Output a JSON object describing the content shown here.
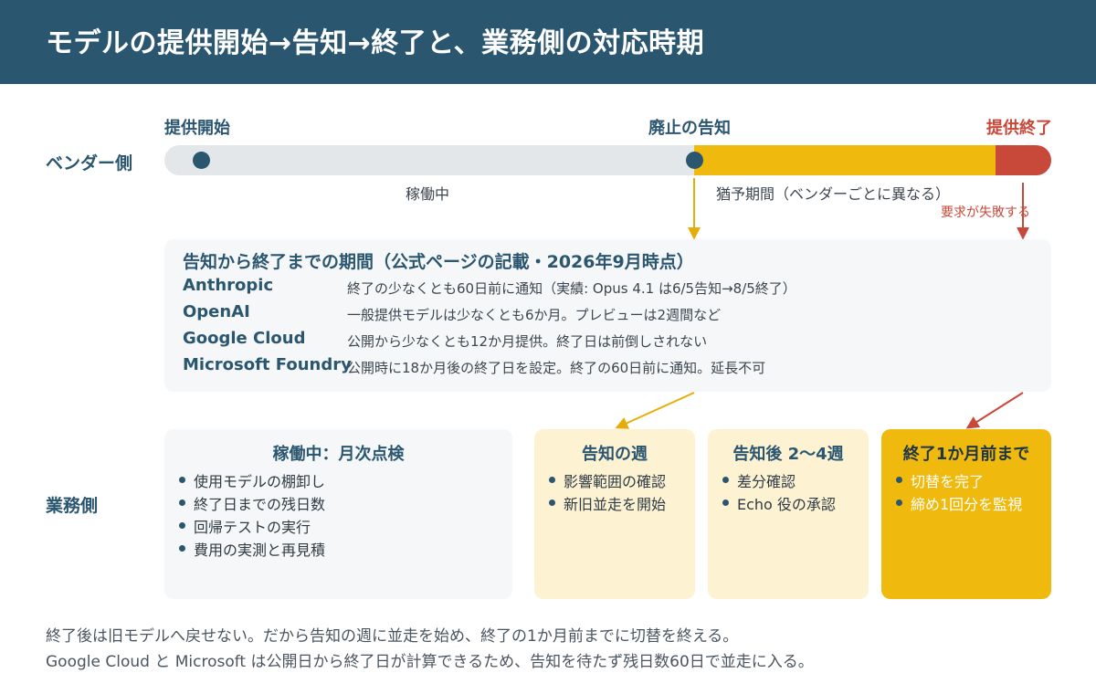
{
  "title": "モデルの提供開始→告知→終了と、業務側の対応時期",
  "vendor_side_label": "ベンダー側",
  "business_side_label": "業務側",
  "timeline": {
    "milestones": {
      "start": "提供開始",
      "notice": "廃止の告知",
      "end": "提供終了"
    },
    "running_label": "稼働中",
    "grace_label": "猶予期間（ベンダーごとに異なる）",
    "fail_label": "要求が失敗する"
  },
  "info_box": {
    "title": "告知から終了までの期間（公式ページの記載・2026年9月時点）",
    "vendors": [
      {
        "name": "Anthropic",
        "desc": "終了の少なくとも60日前に通知（実績: Opus 4.1 は6/5告知→8/5終了）"
      },
      {
        "name": "OpenAI",
        "desc": "一般提供モデルは少なくとも6か月。プレビューは2週間など"
      },
      {
        "name": "Google Cloud",
        "desc": "公開から少なくとも12か月提供。終了日は前倒しされない"
      },
      {
        "name": "Microsoft Foundry",
        "desc": "公開時に18か月後の終了日を設定。終了の60日前に通知。延長不可"
      }
    ]
  },
  "cards": [
    {
      "title": "稼働中：月次点検",
      "items": [
        "使用モデルの棚卸し",
        "終了日までの残日数",
        "回帰テストの実行",
        "費用の実測と再見積"
      ]
    },
    {
      "title": "告知の週",
      "items": [
        "影響範囲の確認",
        "新旧並走を開始"
      ]
    },
    {
      "title": "告知後 2〜4週",
      "items": [
        "差分確認",
        "Echo 役の承認"
      ]
    },
    {
      "title": "終了1か月前まで",
      "items": [
        "切替を完了",
        "締め1回分を監視"
      ]
    }
  ],
  "footer_notes": [
    "終了後は旧モデルへ戻せない。だから告知の週に並走を始め、終了の1か月前までに切替を終える。",
    "Google Cloud と Microsoft は公開日から終了日が計算できるため、告知を待たず残日数60日で並走に入る。"
  ],
  "colors": {
    "header": "#2b5670",
    "grace": "#f0b90d",
    "end": "#c8483a",
    "track": "#e3e7ea"
  }
}
